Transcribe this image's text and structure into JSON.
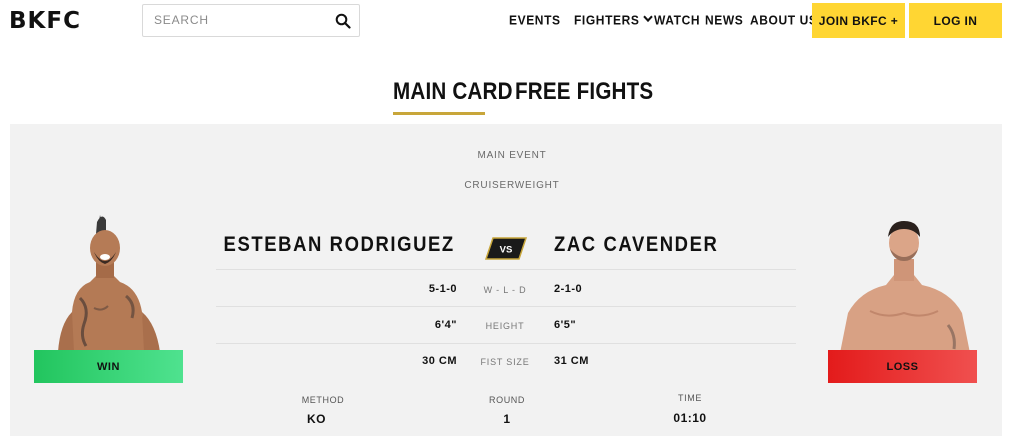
{
  "header": {
    "logo": "BKFC",
    "search_placeholder": "SEARCH",
    "nav": {
      "events": "EVENTS",
      "fighters": "FIGHTERS",
      "watch": "WATCH",
      "news": "NEWS",
      "about": "ABOUT US"
    },
    "join_label": "JOIN BKFC +",
    "login_label": "LOG IN"
  },
  "tabs": [
    {
      "label": "MAIN CARD",
      "active": true
    },
    {
      "label": "FREE FIGHTS",
      "active": false
    }
  ],
  "bout": {
    "position": "MAIN EVENT",
    "weight_class": "CRUISERWEIGHT",
    "vs_label": "VS",
    "fighter_left": {
      "name": "ESTEBAN RODRIGUEZ",
      "result": "WIN",
      "record": "5-1-0",
      "height": "6'4\"",
      "fist_size": "30 CM"
    },
    "fighter_right": {
      "name": "ZAC CAVENDER",
      "result": "LOSS",
      "record": "2-1-0",
      "height": "6'5\"",
      "fist_size": "31 CM"
    },
    "stat_labels": {
      "record": "W - L - D",
      "height": "HEIGHT",
      "fist_size": "FIST SIZE"
    },
    "outcome": {
      "method_label": "METHOD",
      "method": "KO",
      "round_label": "ROUND",
      "round": "1",
      "time_label": "TIME",
      "time": "01:10"
    }
  },
  "colors": {
    "accent_yellow": "#ffd633",
    "tab_underline": "#c8a63a",
    "win_green": "#2fd072",
    "loss_red": "#e8363a",
    "card_bg": "#f2f2f2"
  },
  "icons": [
    "search-icon",
    "chevron-down-icon"
  ]
}
